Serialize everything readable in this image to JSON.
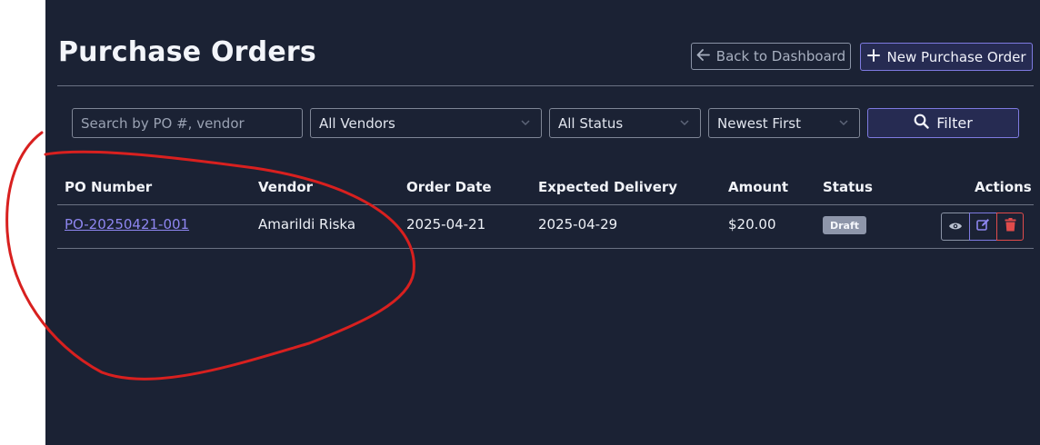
{
  "page": {
    "title": "Purchase Orders"
  },
  "header": {
    "back_label": "Back to Dashboard",
    "new_label": "New Purchase Order"
  },
  "filters": {
    "search_placeholder": "Search by PO #, vendor",
    "vendor_selected": "All Vendors",
    "status_selected": "All Status",
    "sort_selected": "Newest First",
    "filter_label": "Filter"
  },
  "table": {
    "columns": [
      "PO Number",
      "Vendor",
      "Order Date",
      "Expected Delivery",
      "Amount",
      "Status",
      "Actions"
    ],
    "rows": [
      {
        "po_number": "PO-20250421-001",
        "vendor": "Amarildi Riska",
        "order_date": "2025-04-21",
        "expected_delivery": "2025-04-29",
        "amount": "$20.00",
        "status": "Draft"
      }
    ]
  },
  "icons": {
    "back": "arrow-left-icon",
    "new": "plus-icon",
    "filter": "search-icon",
    "view": "eye-icon",
    "edit": "edit-icon",
    "delete": "trash-icon"
  },
  "colors": {
    "background": "#1b2234",
    "accent": "#7e7ae0",
    "link": "#8e86f0",
    "danger": "#e04b4b",
    "annotation": "#d8201f"
  }
}
